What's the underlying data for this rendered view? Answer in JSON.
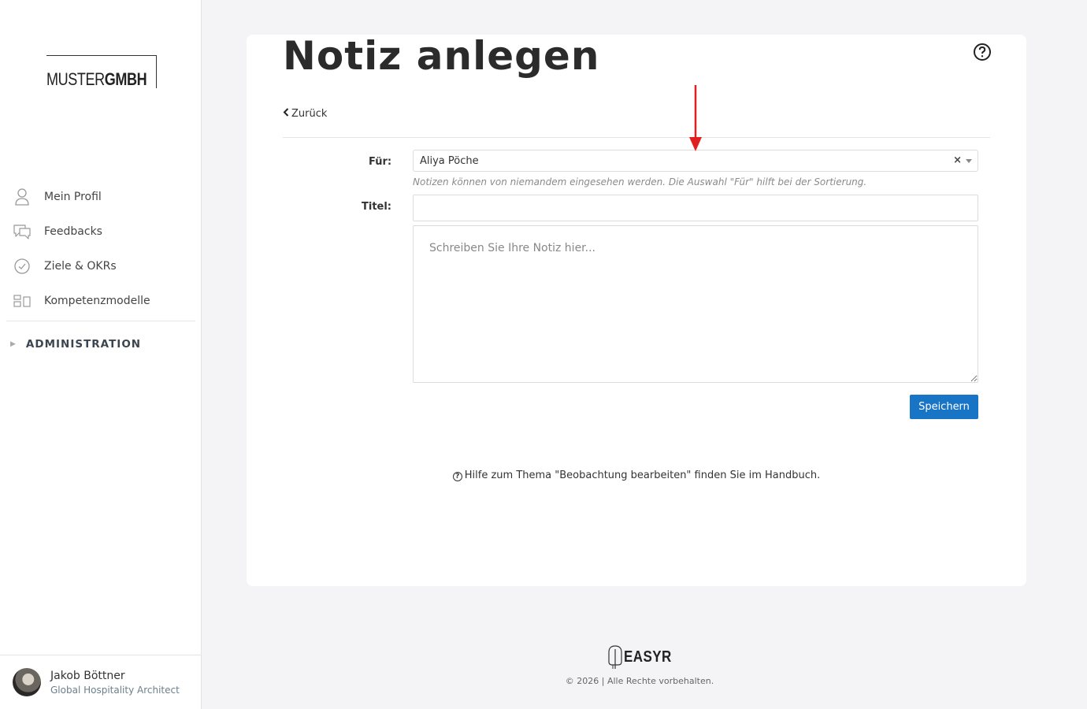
{
  "sidebar": {
    "logo": {
      "light": "MUSTER",
      "bold": "GMBH"
    },
    "items": [
      {
        "label": "Mein Profil",
        "icon": "user-icon"
      },
      {
        "label": "Feedbacks",
        "icon": "chat-icon"
      },
      {
        "label": "Ziele & OKRs",
        "icon": "check-circle-icon"
      },
      {
        "label": "Kompetenzmodelle",
        "icon": "modules-icon"
      }
    ],
    "admin_label": "ADMINISTRATION",
    "user": {
      "name": "Jakob Böttner",
      "role": "Global Hospitality Architect"
    }
  },
  "main": {
    "title": "Notiz anlegen",
    "back_label": "Zurück",
    "form": {
      "for_label": "Für:",
      "for_value": "Aliya Pöche",
      "clear_symbol": "×",
      "hint": "Notizen können von niemandem eingesehen werden. Die Auswahl \"Für\" hilft bei der Sortierung.",
      "title_label": "Titel:",
      "title_value": "",
      "note_placeholder": "Schreiben Sie Ihre Notiz hier...",
      "save_label": "Speichern"
    },
    "help_text": "Hilfe zum Thema \"Beobachtung bearbeiten\" finden Sie im Handbuch."
  },
  "footer": {
    "brand": "EASYR",
    "copyright": "© 2026 | Alle Rechte vorbehalten."
  },
  "colors": {
    "primary": "#1874c4",
    "annotation_arrow": "#e02020",
    "background": "#f4f4f6"
  }
}
